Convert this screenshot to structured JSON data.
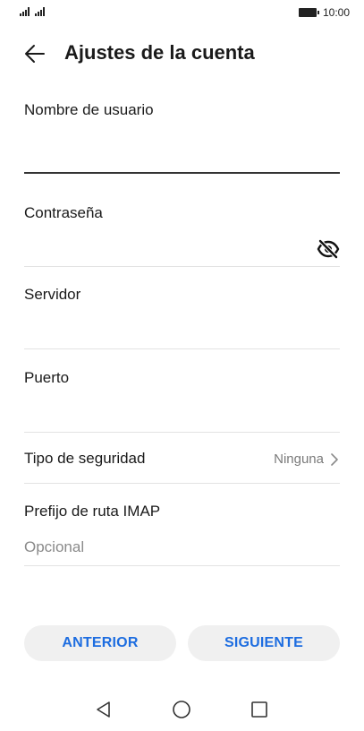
{
  "status_bar": {
    "time": "10:00"
  },
  "header": {
    "title": "Ajustes de la cuenta"
  },
  "form": {
    "username": {
      "label": "Nombre de usuario",
      "value": ""
    },
    "password": {
      "label": "Contraseña",
      "value": ""
    },
    "server": {
      "label": "Servidor",
      "value": ""
    },
    "port": {
      "label": "Puerto",
      "value": ""
    },
    "security": {
      "label": "Tipo de seguridad",
      "value": "Ninguna"
    },
    "imap_prefix": {
      "label": "Prefijo de ruta IMAP",
      "placeholder": "Opcional"
    }
  },
  "buttons": {
    "previous": "ANTERIOR",
    "next": "SIGUIENTE"
  },
  "colors": {
    "accent": "#1d6de0",
    "button_bg": "#f0f0f0",
    "divider": "#e3e3e3"
  },
  "icons": [
    "signal-icon",
    "battery-icon",
    "back-arrow-icon",
    "eye-off-icon",
    "chevron-right-icon",
    "nav-back-icon",
    "nav-home-icon",
    "nav-recents-icon"
  ]
}
